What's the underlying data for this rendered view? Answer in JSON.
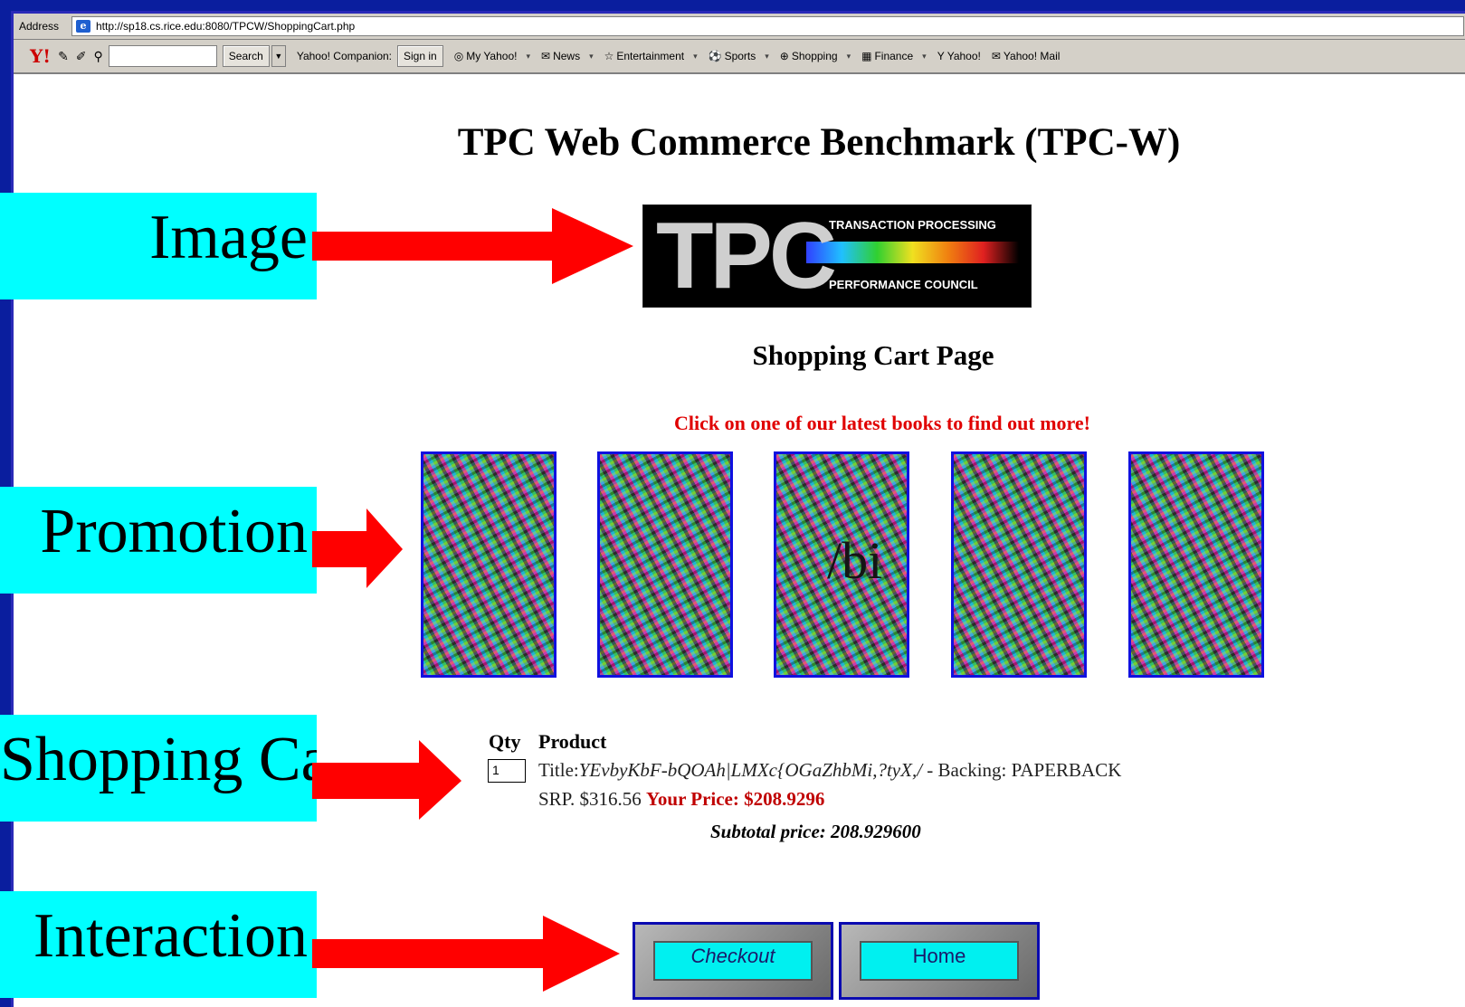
{
  "browser": {
    "address_label": "Address",
    "url": "http://sp18.cs.rice.edu:8080/TPCW/ShoppingCart.php"
  },
  "yahoo_toolbar": {
    "logo": "Y!",
    "search_label": "Search",
    "companion_label": "Yahoo! Companion:",
    "sign_in_label": "Sign in",
    "items": [
      {
        "icon": "my-yahoo-icon",
        "label": "My Yahoo!"
      },
      {
        "icon": "news-icon",
        "label": "News"
      },
      {
        "icon": "entertainment-icon",
        "label": "Entertainment"
      },
      {
        "icon": "sports-icon",
        "label": "Sports"
      },
      {
        "icon": "shopping-icon",
        "label": "Shopping"
      },
      {
        "icon": "finance-icon",
        "label": "Finance"
      },
      {
        "icon": "yahoo-icon",
        "label": "Yahoo!"
      },
      {
        "icon": "mail-icon",
        "label": "Yahoo! Mail"
      }
    ]
  },
  "page": {
    "title": "TPC Web Commerce Benchmark (TPC-W)",
    "logo": {
      "letters": "TPC",
      "line1": "TRANSACTION PROCESSING",
      "line2": "PERFORMANCE COUNCIL"
    },
    "heading": "Shopping Cart Page",
    "promo_text": "Click on one of our latest books to find out more!",
    "books": [
      {
        "overlay": ""
      },
      {
        "overlay": ""
      },
      {
        "overlay": "/bi"
      },
      {
        "overlay": ""
      },
      {
        "overlay": ""
      }
    ],
    "cart": {
      "qty_header": "Qty",
      "product_header": "Product",
      "qty_value": "1",
      "title_label": "Title:",
      "title_value": "YEvbyKbF-bQOAh|LMXc{OGaZhbMi,?tyX,/",
      "backing_text": " - Backing: PAPERBACK",
      "srp_text": "SRP. $316.56 ",
      "your_price": "Your Price: $208.9296",
      "subtotal": "Subtotal price: 208.929600"
    },
    "buttons": {
      "checkout": "Checkout",
      "home": "Home"
    }
  },
  "annotations": {
    "image": "Image",
    "promotion": "Promotion",
    "shopping_cart": "Shopping Cart",
    "interaction": "Interaction"
  },
  "colors": {
    "slide_background": "#0a1e9e",
    "label_background": "#00ffff",
    "arrow": "#ff0000",
    "promo_text": "#e00000",
    "button_face": "#00f0f0"
  }
}
